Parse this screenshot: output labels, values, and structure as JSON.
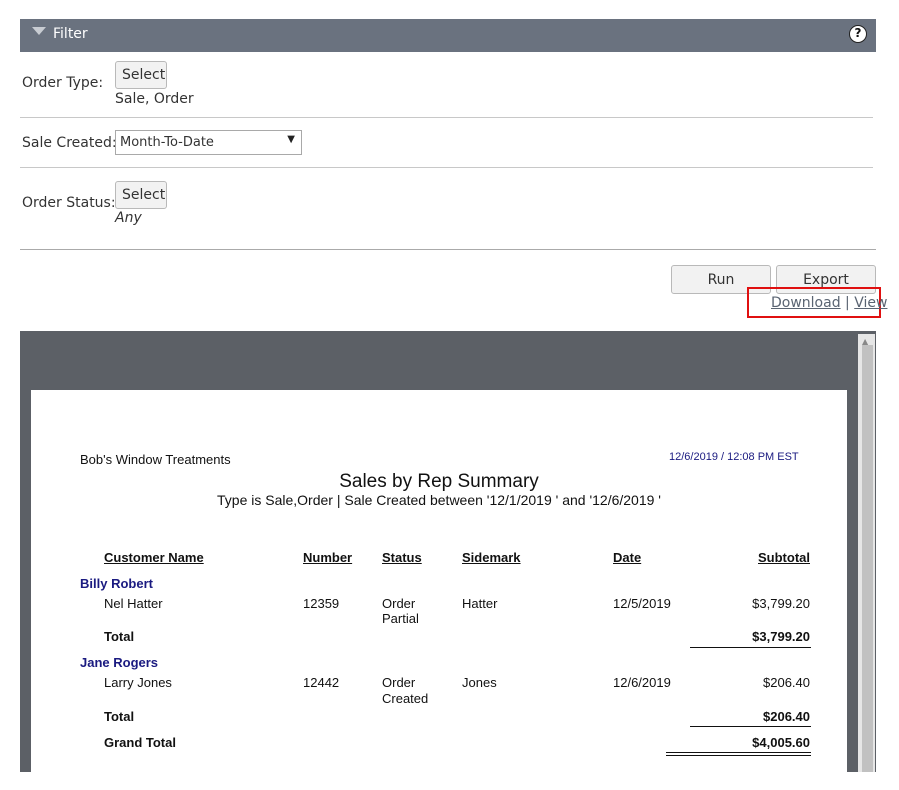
{
  "filter": {
    "title": "Filter",
    "help_glyph": "?",
    "order_type": {
      "label": "Order Type:",
      "button": "Select",
      "value": "Sale, Order"
    },
    "sale_created": {
      "label": "Sale Created:",
      "value": "Month-To-Date",
      "arrow": "▼"
    },
    "order_status": {
      "label": "Order Status:",
      "button": "Select",
      "value": "Any"
    }
  },
  "actions": {
    "run": "Run",
    "export": "Export",
    "download": "Download",
    "separator": "|",
    "view": "View"
  },
  "report": {
    "company": "Bob's Window Treatments",
    "timestamp": "12/6/2019  / 12:08 PM EST",
    "title": "Sales by Rep Summary",
    "subtitle": "Type is Sale,Order | Sale Created between '12/1/2019 ' and '12/6/2019 '",
    "columns": [
      "Customer Name",
      "Number",
      "Status",
      "Sidemark",
      "Date",
      "Subtotal"
    ],
    "groups": [
      {
        "customer": "Billy Robert",
        "rows": [
          {
            "name": "Nel Hatter",
            "number": "12359",
            "status1": "Order",
            "status2": "Partial",
            "sidemark": "Hatter",
            "date": "12/5/2019",
            "subtotal": "$3,799.20"
          }
        ],
        "total_label": "Total",
        "total": "$3,799.20"
      },
      {
        "customer": "Jane Rogers",
        "rows": [
          {
            "name": "Larry Jones",
            "number": "12442",
            "status1": "Order",
            "status2": "Created",
            "sidemark": "Jones",
            "date": "12/6/2019",
            "subtotal": "$206.40"
          }
        ],
        "total_label": "Total",
        "total": "$206.40"
      }
    ],
    "grand_total_label": "Grand Total",
    "grand_total": "$4,005.60"
  },
  "colors": {
    "header_bg": "#6a727f",
    "highlight": "#e01010",
    "customer_text": "#1a1a80",
    "timestamp_text": "#1a1a80"
  }
}
